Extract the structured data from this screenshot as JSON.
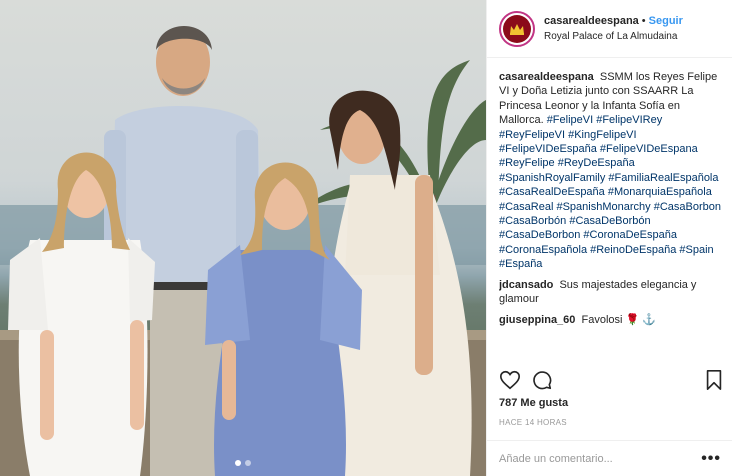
{
  "post": {
    "username": "casarealdeespana",
    "separator": "•",
    "follow_label": "Seguir",
    "location": "Royal Palace of La Almudaina",
    "caption_user": "casarealdeespana",
    "caption_text": "SSMM los Reyes Felipe VI y Doña Letizia junto con SSAARR La Princesa Leonor y la Infanta Sofía en Mallorca.",
    "caption_tags": "#FelipeVI #FelipeVIRey #ReyFelipeVI #KingFelipeVI #FelipeVIDeEspaña #FelipeVIDeEspana #ReyFelipe #ReyDeEspaña #SpanishRoyalFamily #FamiliaRealEspañola #CasaRealDeEspaña #MonarquiaEspañola #CasaReal #SpanishMonarchy #CasaBorbon #CasaBorbón #CasaDeBorbón #CasaDeBorbon #CoronaDeEspaña #CoronaEspañola #ReinoDeEspaña #Spain #España",
    "comments": [
      {
        "user": "jdcansado",
        "text": "Sus majestades elegancia y glamour"
      },
      {
        "user": "giuseppina_60",
        "text": "Favolosi 🌹 ⚓"
      }
    ],
    "likes": "787 Me gusta",
    "time": "HACE 14 HORAS",
    "comment_placeholder": "Añade un comentario...",
    "more_label": "•••",
    "icons": {
      "like": "heart-icon",
      "comment": "comment-icon",
      "save": "bookmark-icon",
      "avatar": "crown-icon"
    },
    "colors": {
      "follow": "#3897f0",
      "hashtag": "#003569",
      "avatar_ring": "#c13584",
      "avatar_bg": "#8b0a1a"
    },
    "carousel": {
      "total": 2,
      "active": 1
    }
  }
}
